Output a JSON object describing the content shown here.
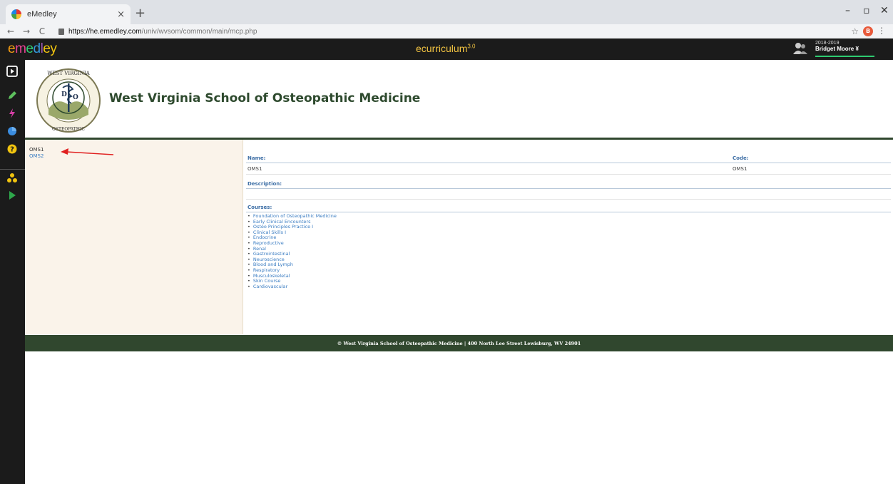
{
  "browser": {
    "tab_title": "eMedley",
    "tab_close": "×",
    "new_tab": "+",
    "url_host": "https://he.emedley.com",
    "url_path": "/univ/wvsom/common/main/mcp.php",
    "profile_initial": "B",
    "window_controls": [
      "–",
      "▫",
      "✕"
    ]
  },
  "app": {
    "logo": [
      "e",
      "m",
      "e",
      "d",
      "l",
      "ey"
    ],
    "title": "ecurriculum",
    "title_version": "3.0",
    "user": {
      "year": "2018-2019",
      "name": "Bridget Moore ¥"
    }
  },
  "sidebar": {
    "icons": [
      "presentation-icon",
      "pencil-icon",
      "lightning-icon",
      "pie-chart-icon",
      "help-icon",
      "org-icon",
      "play-icon"
    ]
  },
  "school": {
    "name": "West Virginia School of Osteopathic Medicine",
    "seal_text": [
      "WEST VIRGINIA",
      "SCHOOL",
      "OF",
      "OSTEOPATHIC",
      "MEDICINE",
      "D",
      "O"
    ]
  },
  "tree": {
    "selected": "OMS1",
    "items": [
      "OMS2"
    ]
  },
  "detail": {
    "name_label": "Name:",
    "name_value": "OMS1",
    "code_label": "Code:",
    "code_value": "OMS1",
    "description_label": "Description:",
    "courses_label": "Courses:",
    "courses": [
      "Foundation of Osteopathic Medicine",
      "Early Clinical Encounters",
      "Osteo Principles Practice I",
      "Clinical Skills I",
      "Endocrine",
      "Reproductive",
      "Renal",
      "Gastrointestinal",
      "Neuroscience",
      "Blood and Lymph",
      "Respiratory",
      "Musculoskeletal",
      "Skin Course",
      "Cardiovascular"
    ]
  },
  "footer": {
    "text": "© West Virginia School of Osteopathic Medicine | 400 North Lee Street Lewisburg, WV 24901"
  },
  "colors": {
    "brand_green": "#30472e",
    "link_blue": "#3a7cc2",
    "label_blue": "#3e6fa6",
    "header_dark": "#1b1b1b",
    "title_gold": "#f4c542",
    "arrow_red": "#e02020"
  }
}
